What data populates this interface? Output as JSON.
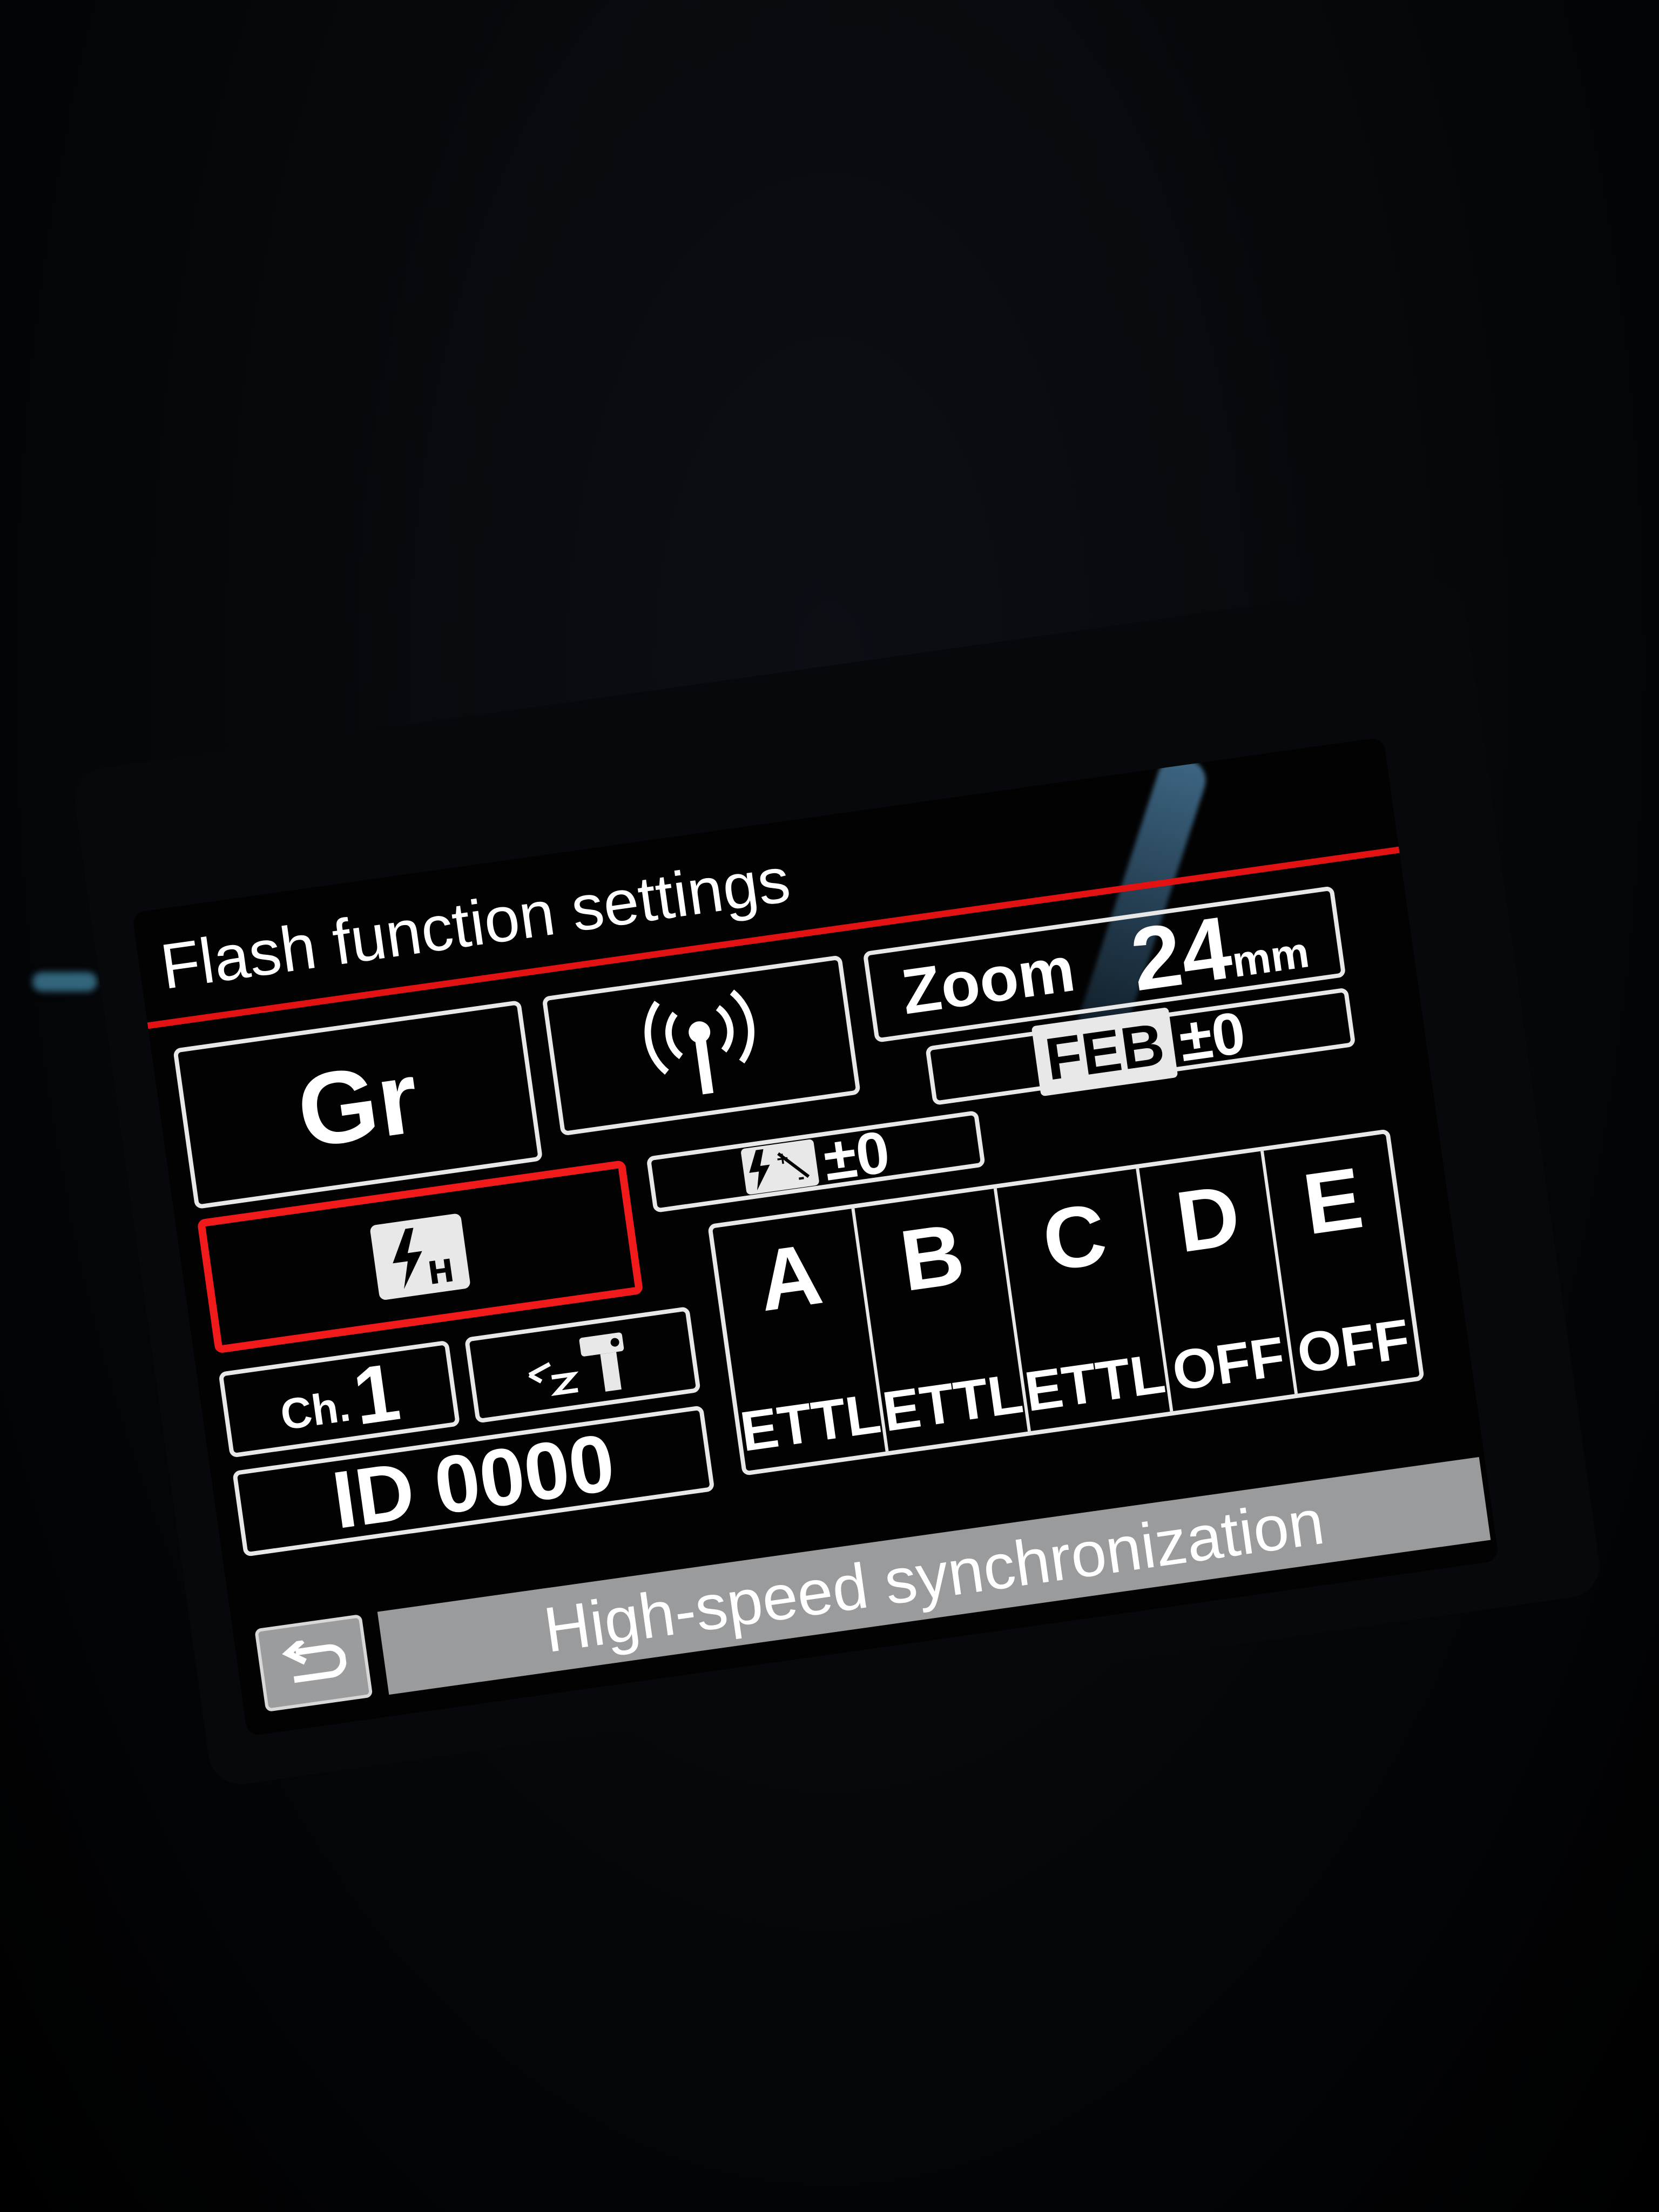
{
  "screen": {
    "title": "Flash function settings",
    "wireless_mode": "Gr",
    "zoom_label": "Zoom",
    "zoom_value": "24",
    "zoom_unit": "mm",
    "feb_label": "FEB",
    "feb_value": "±0",
    "fec_value": "±0",
    "channel_label": "Ch.",
    "channel_value": "1",
    "id_label": "ID",
    "id_value": "0000",
    "groups": [
      {
        "letter": "A",
        "mode": "ETTL"
      },
      {
        "letter": "B",
        "mode": "ETTL"
      },
      {
        "letter": "C",
        "mode": "ETTL"
      },
      {
        "letter": "D",
        "mode": "OFF"
      },
      {
        "letter": "E",
        "mode": "OFF"
      }
    ],
    "status_text": "High-speed synchronization"
  },
  "colors": {
    "accent": "#e31212",
    "selection": "#f01a1a",
    "foreground": "#ffffff",
    "status_bar": "#999b9d",
    "background": "#020203"
  },
  "icons": {
    "sync_mode": "high-speed-sync-icon",
    "wireless": "radio-wireless-icon",
    "fec": "flash-exposure-compensation-icon",
    "master": "master-flash-icon",
    "back": "return-arrow-icon"
  }
}
